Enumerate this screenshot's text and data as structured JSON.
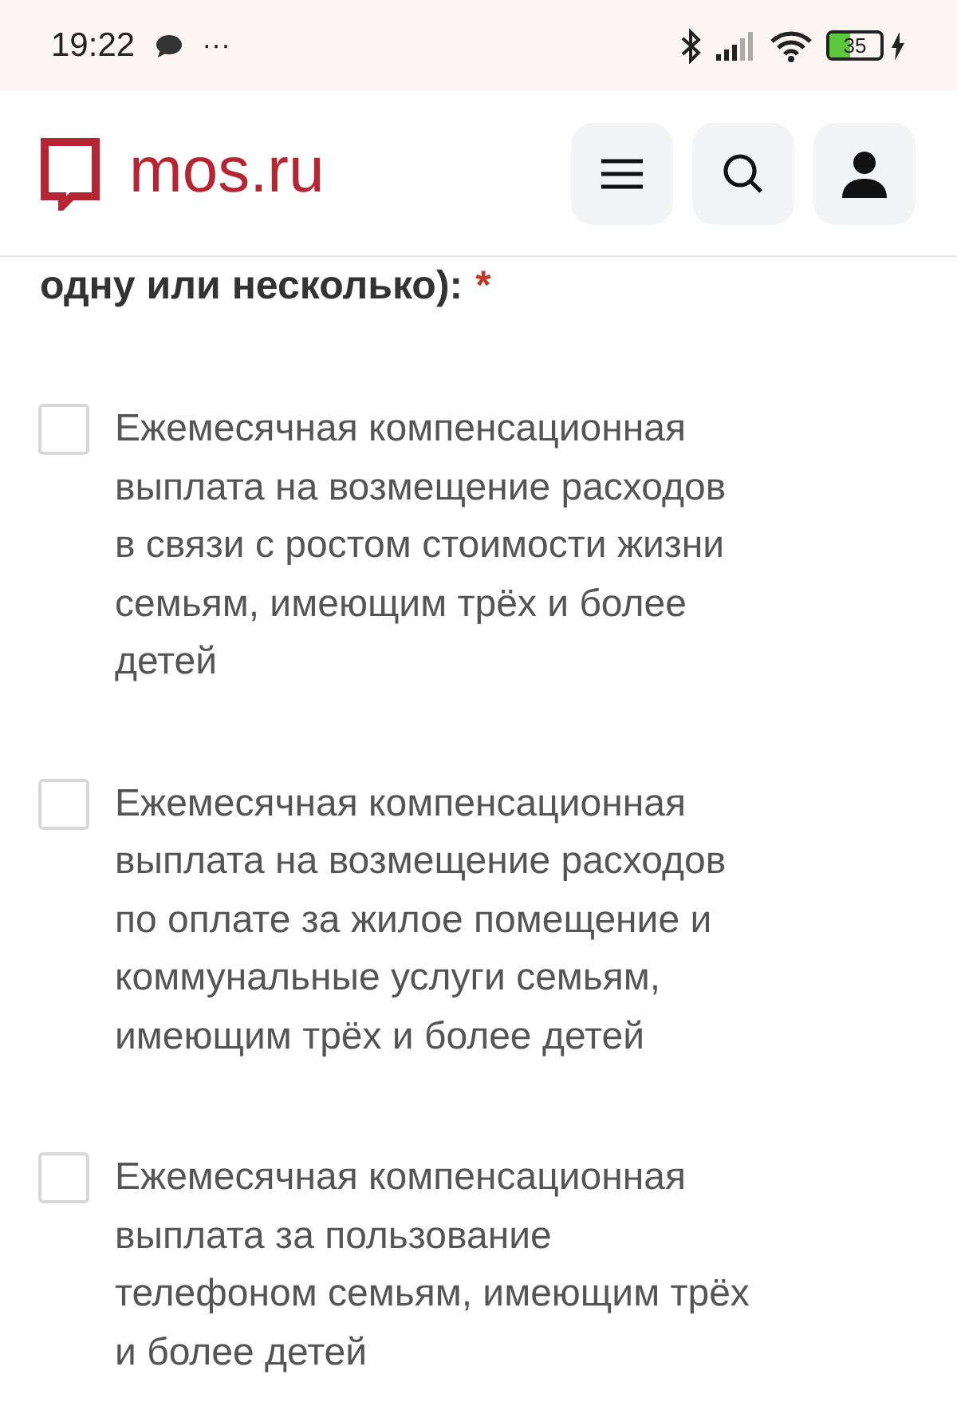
{
  "status_bar": {
    "time": "19:22",
    "more": "···",
    "battery": "35"
  },
  "header": {
    "logo": "mos.ru"
  },
  "question": {
    "text": "одну или несколько):",
    "required_mark": "*"
  },
  "options": [
    {
      "label": "Ежемесячная компенсационная выплата на возмещение расходов в связи с ростом стоимости жизни семьям, имеющим трёх и более детей",
      "checked": false
    },
    {
      "label": "Ежемесячная компенсационная выплата на возмещение расходов по оплате за жилое помещение и коммунальные услуги семьям, имеющим трёх и более детей",
      "checked": false
    },
    {
      "label": "Ежемесячная компенсационная выплата за пользование телефоном семьям, имеющим трёх и более детей",
      "checked": false
    }
  ]
}
